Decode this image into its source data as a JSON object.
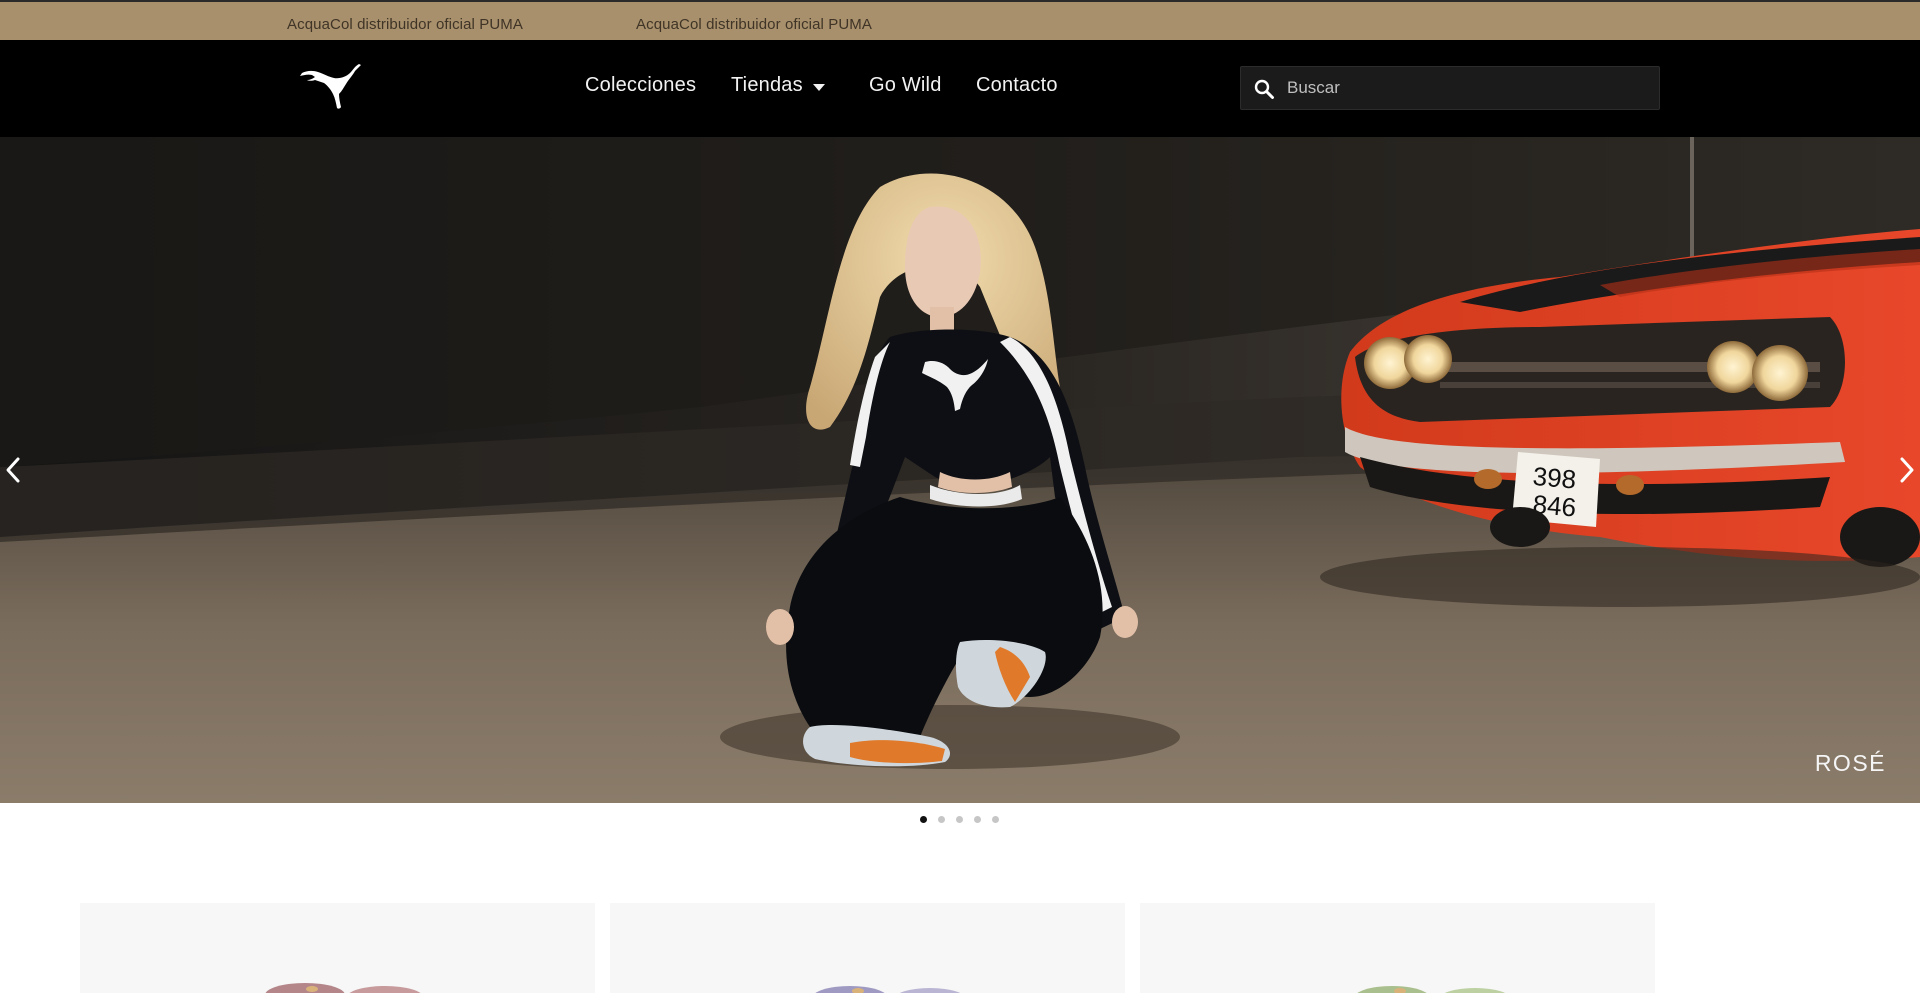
{
  "announcement": {
    "messages": [
      "AcquaCol distribuidor oficial PUMA",
      "AcquaCol distribuidor oficial PUMA"
    ]
  },
  "header": {
    "logo_icon": "puma-cat-logo",
    "nav": [
      {
        "label": "Colecciones"
      },
      {
        "label": "Tiendas",
        "icon": "chevron-down-icon"
      },
      {
        "label": "Go Wild"
      },
      {
        "label": "Contacto"
      }
    ],
    "search": {
      "placeholder": "Buscar",
      "value": "",
      "icon": "search-icon"
    }
  },
  "hero": {
    "caption": "ROSÉ",
    "prev_icon": "chevron-left-icon",
    "next_icon": "chevron-right-icon",
    "slide_count": 5,
    "active_slide": 1,
    "car_plate": [
      "398",
      "846"
    ]
  },
  "colors": {
    "announcement_bg": "#a8906c",
    "header_bg": "#000000",
    "search_bg": "#1b1b1b",
    "dot_active": "#111111",
    "dot_inactive": "#c6c6c6"
  }
}
